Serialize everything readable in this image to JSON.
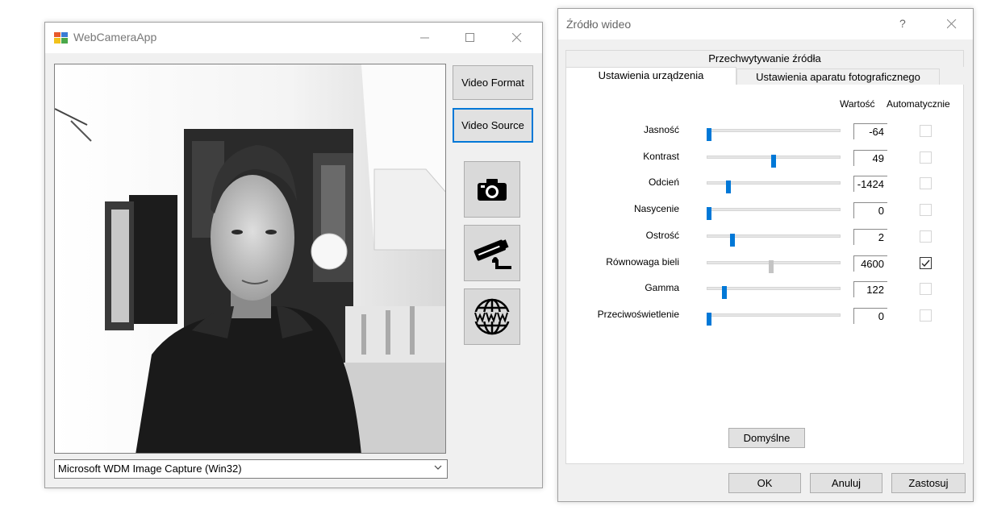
{
  "camera_app": {
    "title": "WebCameraApp",
    "buttons": {
      "video_format": "Video Format",
      "video_source": "Video Source"
    },
    "icon_buttons": [
      "camera-icon",
      "security-camera-icon",
      "www-globe-icon"
    ],
    "device_select": "Microsoft WDM Image Capture (Win32)"
  },
  "source_dialog": {
    "title": "Źródło wideo",
    "help": "?",
    "tabs": {
      "top": "Przechwytywanie źródła",
      "device": "Ustawienia urządzenia",
      "camera": "Ustawienia aparatu fotograficznego"
    },
    "columns": {
      "value": "Wartość",
      "auto": "Automatycznie"
    },
    "properties": [
      {
        "label": "Jasność",
        "value": "-64",
        "slider": 0.0,
        "auto": false
      },
      {
        "label": "Kontrast",
        "value": "49",
        "slider": 0.5,
        "auto": false
      },
      {
        "label": "Odcień",
        "value": "-1424",
        "slider": 0.15,
        "auto": false
      },
      {
        "label": "Nasycenie",
        "value": "0",
        "slider": 0.0,
        "auto": false
      },
      {
        "label": "Ostrość",
        "value": "2",
        "slider": 0.18,
        "auto": false
      },
      {
        "label": "Równowaga bieli",
        "value": "4600",
        "slider": 0.48,
        "auto": true
      },
      {
        "label": "Gamma",
        "value": "122",
        "slider": 0.12,
        "auto": false
      },
      {
        "label": "Przeciwoświetlenie",
        "value": "0",
        "slider": 0.0,
        "auto": false
      }
    ],
    "buttons": {
      "defaults": "Domyślne",
      "ok": "OK",
      "cancel": "Anuluj",
      "apply": "Zastosuj"
    }
  }
}
